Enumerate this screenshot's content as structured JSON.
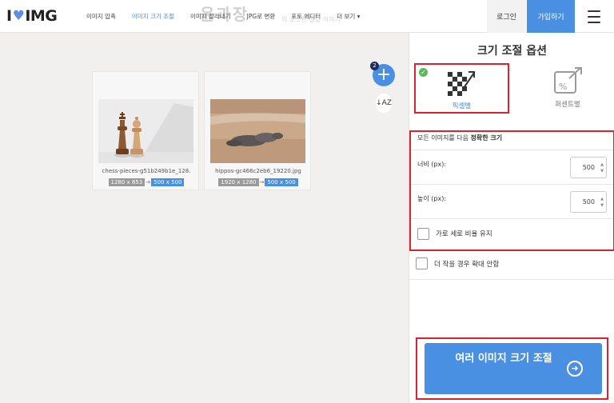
{
  "header": {
    "logo_left": "I",
    "logo_right": "IMG",
    "nav": [
      "이미지 압축",
      "이미지 크기 조절",
      "이미지 잘라내기",
      "JPG로 변환",
      "포토 에디터",
      "더 보기 ▾"
    ],
    "watermark": "윤과장",
    "watermark_sub": "의 소소한 일상 이야기",
    "login": "로그인",
    "signup": "가입하기"
  },
  "files": [
    {
      "name": "chess-pieces-g51b249b1e_128.",
      "original": "1280 x 853",
      "resized": "500 x 500"
    },
    {
      "name": "hippos-gc466c2eb6_19220.jpg",
      "original": "1920 x 1280",
      "resized": "500 x 500"
    }
  ],
  "workspace": {
    "file_count": "2",
    "add_symbol": "+",
    "sort_symbol": "↓AZ",
    "arrow": "→"
  },
  "panel": {
    "title": "크기 조절 옵션",
    "mode_pixel": "픽셀별",
    "mode_percent": "퍼센트별",
    "desc_prefix": "모든 이미지를 다음 ",
    "desc_bold": "정확한 크기",
    "width_label": "너비 (px):",
    "width_value": "500",
    "height_label": "높이 (px):",
    "height_value": "500",
    "keep_ratio": "가로 세로 비율 유지",
    "no_enlarge": "더 작을 경우 확대 안함",
    "resize_button": "여러 이미지 크기 조절"
  },
  "colors": {
    "accent": "#4a90e2",
    "highlight": "#d9232d",
    "success": "#5cb85c"
  }
}
